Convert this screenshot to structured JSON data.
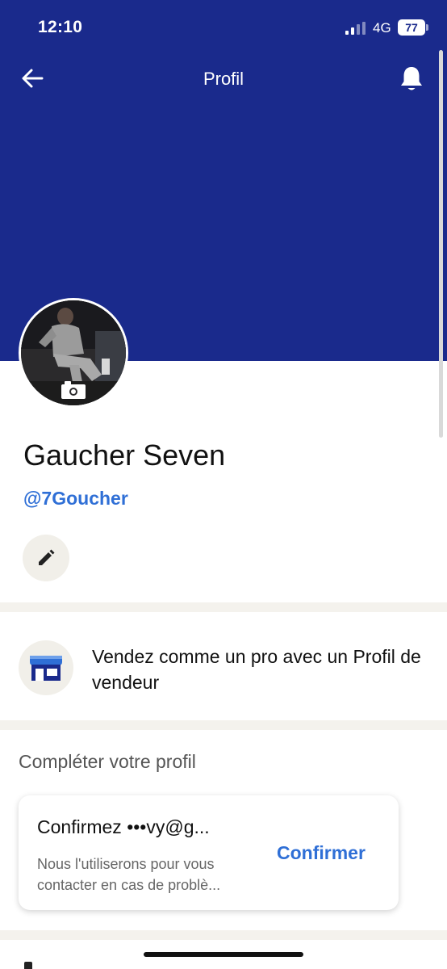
{
  "status_bar": {
    "time": "12:10",
    "network": "4G",
    "battery": "77"
  },
  "header": {
    "title": "Profil",
    "back_icon": "arrow-left-icon",
    "notification_icon": "bell-icon",
    "background_color": "#1a2a8c"
  },
  "profile": {
    "display_name": "Gaucher Seven",
    "username": "@7Goucher",
    "avatar_icon": "camera-icon",
    "edit_icon": "pencil-icon"
  },
  "seller_promo": {
    "icon": "storefront-icon",
    "text": "Vendez comme un pro avec un Profil de vendeur"
  },
  "complete_profile": {
    "title": "Compléter votre profil",
    "card": {
      "title": "Confirmez •••vy@g...",
      "description": "Nous l'utiliserons pour vous contacter en cas de problè...",
      "button_label": "Confirmer"
    }
  },
  "colors": {
    "accent": "#2f6fd6",
    "brand": "#1a2a8c",
    "divider": "#f4f2ed"
  }
}
